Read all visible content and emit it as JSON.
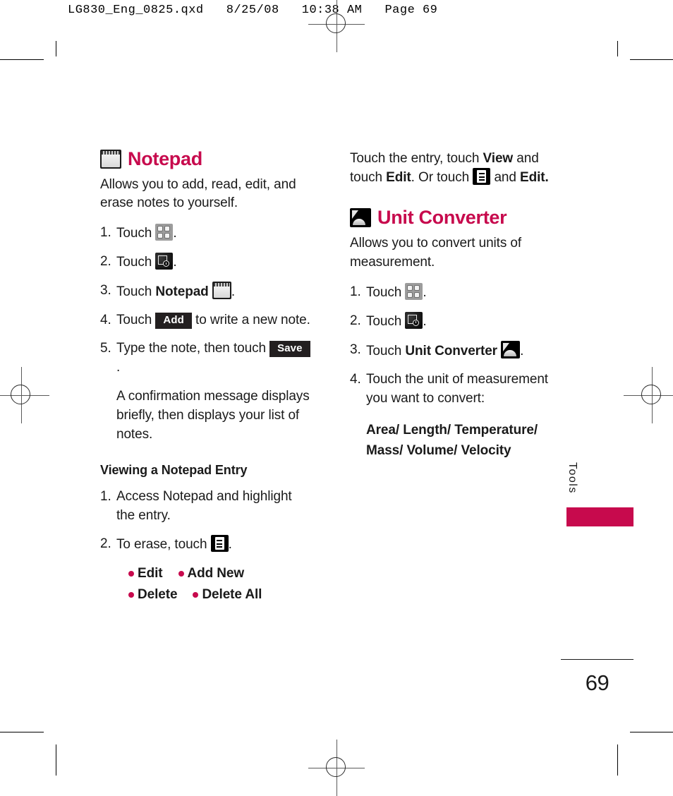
{
  "print_header": "LG830_Eng_0825.qxd   8/25/08   10:38 AM   Page 69",
  "brand_color": "#C70A4D",
  "left_column": {
    "section": {
      "icon": "notepad-icon",
      "title": "Notepad",
      "intro": "Allows you to add, read, edit, and erase notes to yourself."
    },
    "steps": [
      {
        "num": "1.",
        "pre": "Touch ",
        "icon": "grid-menu-icon",
        "post": "."
      },
      {
        "num": "2.",
        "pre": "Touch ",
        "icon": "tools-icon",
        "post": "."
      },
      {
        "num": "3.",
        "pre": "Touch ",
        "bold": "Notepad",
        "icon": "notepad-icon",
        "post": "."
      },
      {
        "num": "4.",
        "pre": "Touch ",
        "key": "Add",
        "post": " to write a new note."
      },
      {
        "num": "5.",
        "pre": "Type the note, then touch ",
        "key": "Save",
        "post": "."
      }
    ],
    "note": "A confirmation message displays briefly, then displays your list of notes.",
    "subsection": {
      "heading": "Viewing a Notepad Entry",
      "steps": [
        {
          "num": "1.",
          "pre": "Access Notepad and highlight the entry.",
          "icon": "",
          "post": ""
        },
        {
          "num": "2.",
          "pre": "To erase, touch ",
          "icon": "list-options-icon",
          "post": "."
        }
      ],
      "bullets": [
        [
          "Edit",
          "Add New"
        ],
        [
          "Delete",
          "Delete All"
        ]
      ]
    }
  },
  "right_column": {
    "continued_para": {
      "t1": "Touch the entry, touch ",
      "b1": "View",
      "t2": " and touch ",
      "b2": "Edit",
      "t3": ". Or touch ",
      "icon": "list-options-icon",
      "t4": " and ",
      "b3": "Edit."
    },
    "section": {
      "icon": "unit-converter-icon",
      "title": "Unit Converter",
      "intro": "Allows you to convert units of measurement."
    },
    "steps": [
      {
        "num": "1.",
        "pre": "Touch ",
        "icon": "grid-menu-icon",
        "post": "."
      },
      {
        "num": "2.",
        "pre": "Touch ",
        "icon": "tools-icon",
        "post": "."
      },
      {
        "num": "3.",
        "pre": "Touch ",
        "bold": "Unit Converter",
        "icon": "unit-converter-icon",
        "post": "."
      },
      {
        "num": "4.",
        "pre": "Touch the unit of measurement you want to convert:",
        "icon": "",
        "post": ""
      }
    ],
    "units_line_1": "Area/ Length/ Temperature/",
    "units_line_2": "Mass/ Volume/ Velocity"
  },
  "side_tab": {
    "label": "Tools"
  },
  "folio": {
    "page_number": "69"
  }
}
